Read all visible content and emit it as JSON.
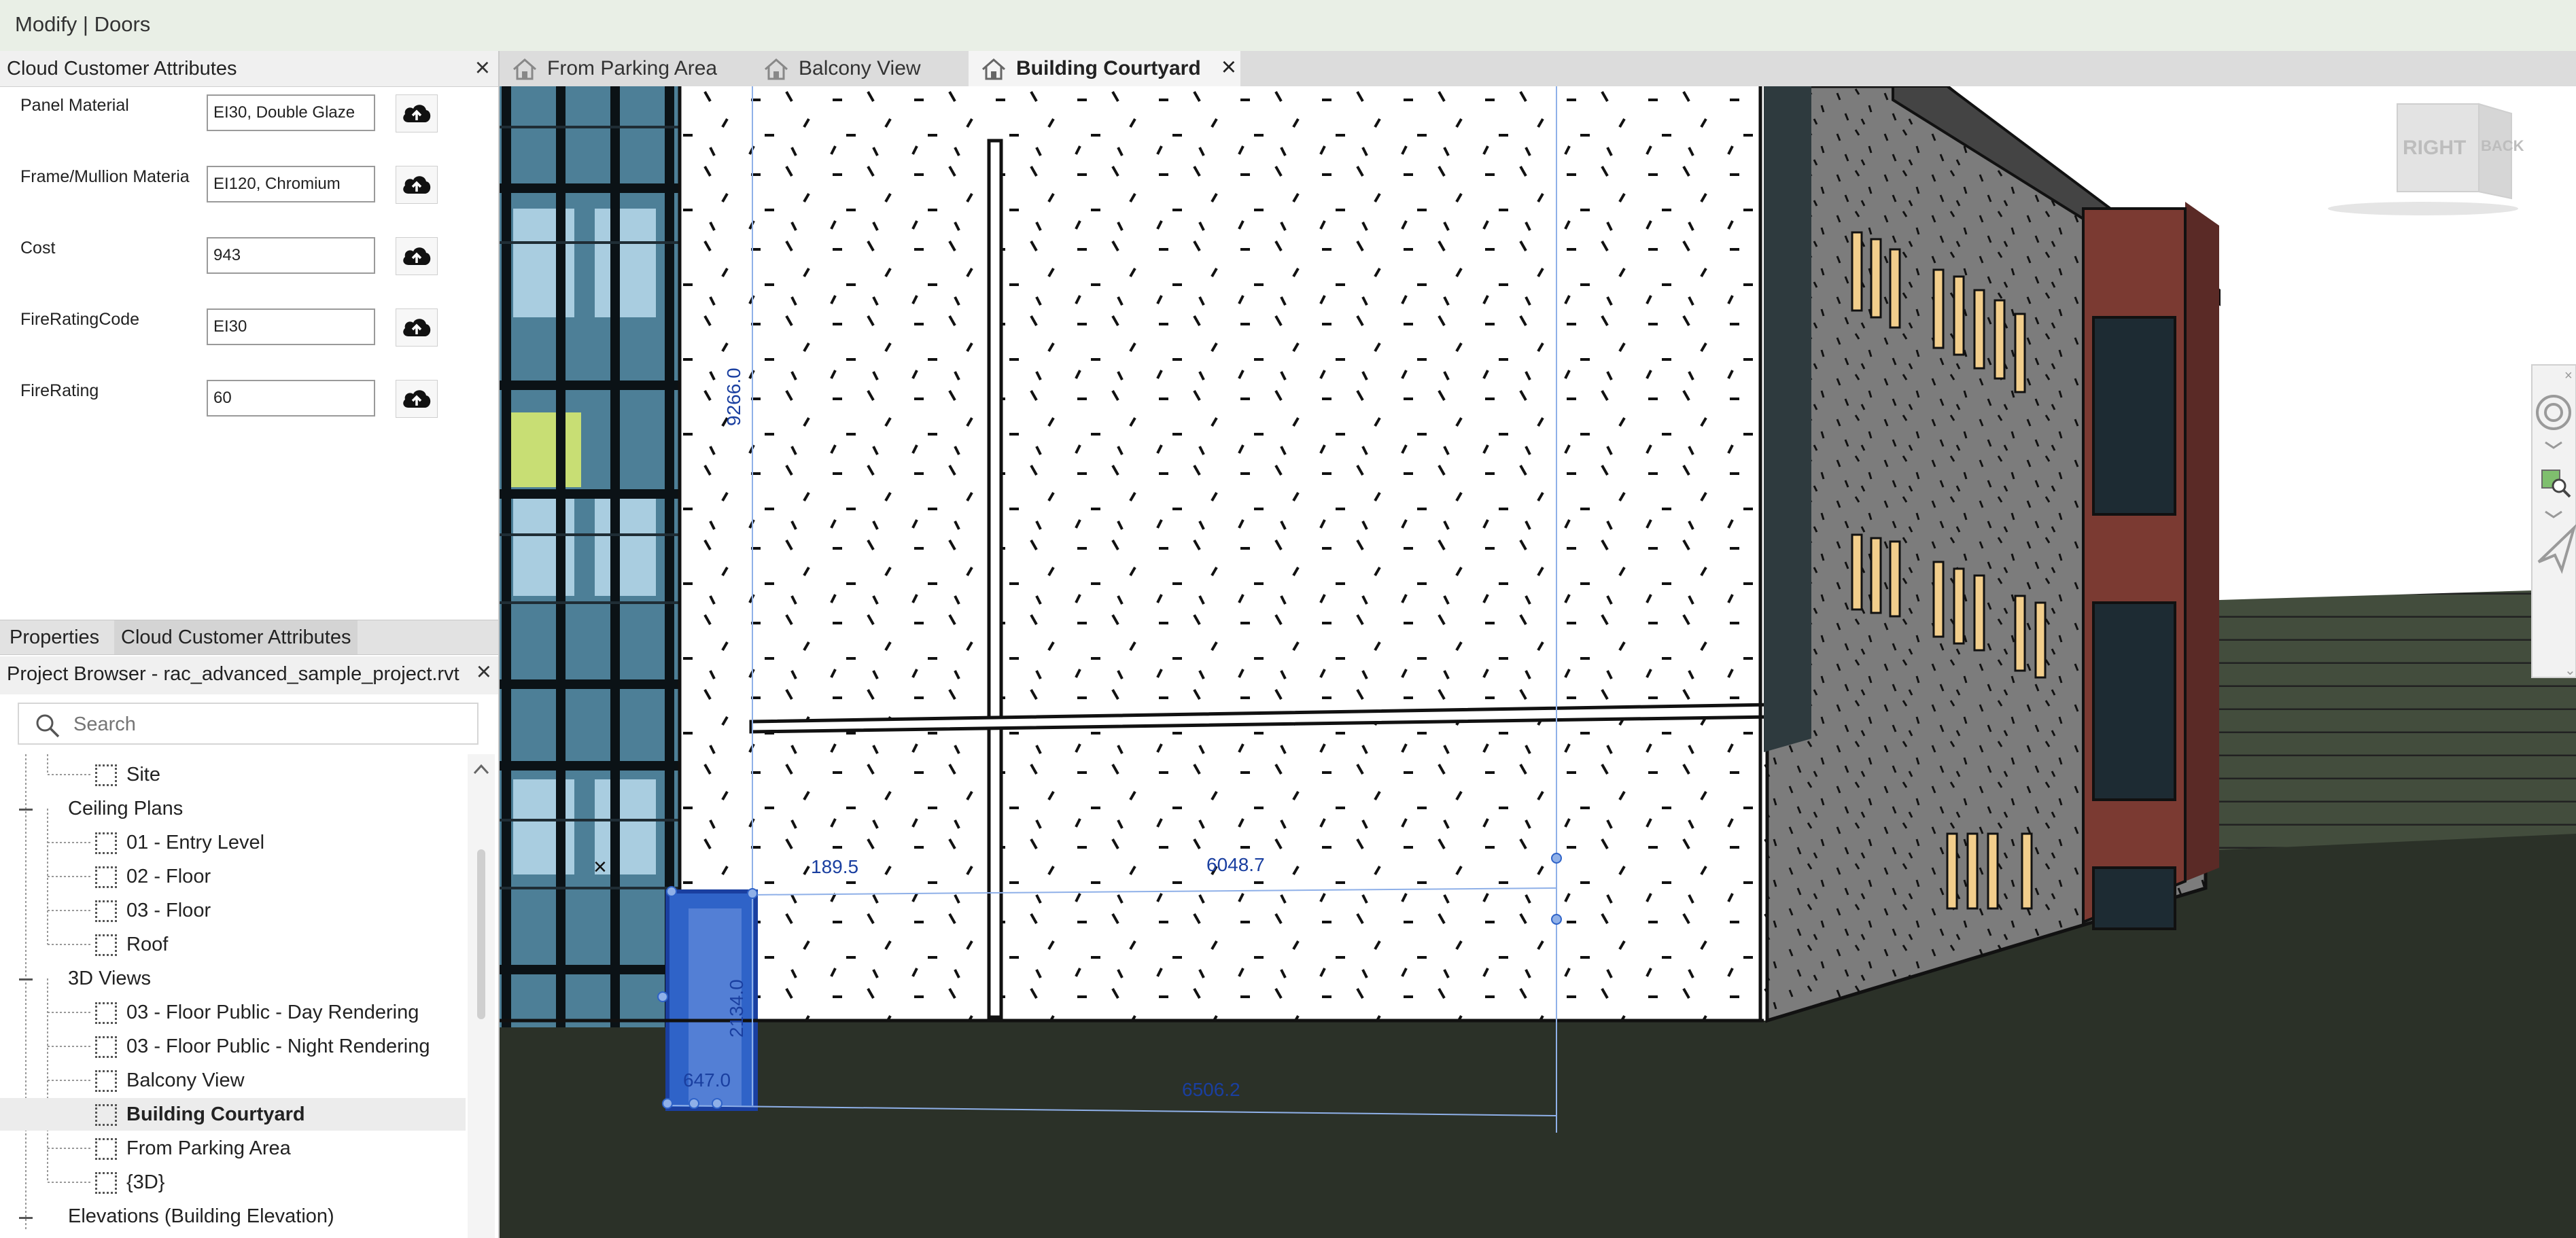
{
  "window": {
    "title": "Modify | Doors"
  },
  "cloud_panel": {
    "title": "Cloud Customer Attributes",
    "fields": [
      {
        "label": "Panel Material",
        "value": "EI30, Double Glaze"
      },
      {
        "label": "Frame/Mullion Materia",
        "value": "EI120, Chromium"
      },
      {
        "label": "Cost",
        "value": "943"
      },
      {
        "label": "FireRatingCode",
        "value": "EI30"
      },
      {
        "label": "FireRating",
        "value": "60"
      }
    ]
  },
  "panel_tabs": {
    "properties": "Properties",
    "cloud": "Cloud Customer Attributes"
  },
  "project_browser": {
    "title": "Project Browser - rac_advanced_sample_project.rvt",
    "search_placeholder": "Search",
    "items": {
      "site": "Site",
      "ceiling_plans": "Ceiling Plans",
      "entry_level": "01 - Entry Level",
      "floor02": "02 - Floor",
      "floor03": "03 - Floor",
      "roof": "Roof",
      "views3d": "3D Views",
      "day": "03 - Floor Public - Day Rendering",
      "night": "03 - Floor Public - Night Rendering",
      "balcony": "Balcony View",
      "courtyard": "Building Courtyard",
      "parking": "From Parking Area",
      "view3d": "{3D}",
      "elevations": "Elevations (Building Elevation)"
    }
  },
  "view_tabs": {
    "parking": "From Parking Area",
    "balcony": "Balcony View",
    "courtyard": "Building Courtyard"
  },
  "viewport": {
    "view_cube": {
      "right": "RIGHT",
      "back": "BACK"
    },
    "dimensions": {
      "height": "9266.0",
      "offset": "189.5",
      "width": "6048.7",
      "door_width": "647.0",
      "door_height": "2134.0",
      "base": "6506.2"
    },
    "colors": {
      "selection": "#2f63c8",
      "dimension": "#1a3fa0",
      "ground": "#2b3128"
    }
  }
}
